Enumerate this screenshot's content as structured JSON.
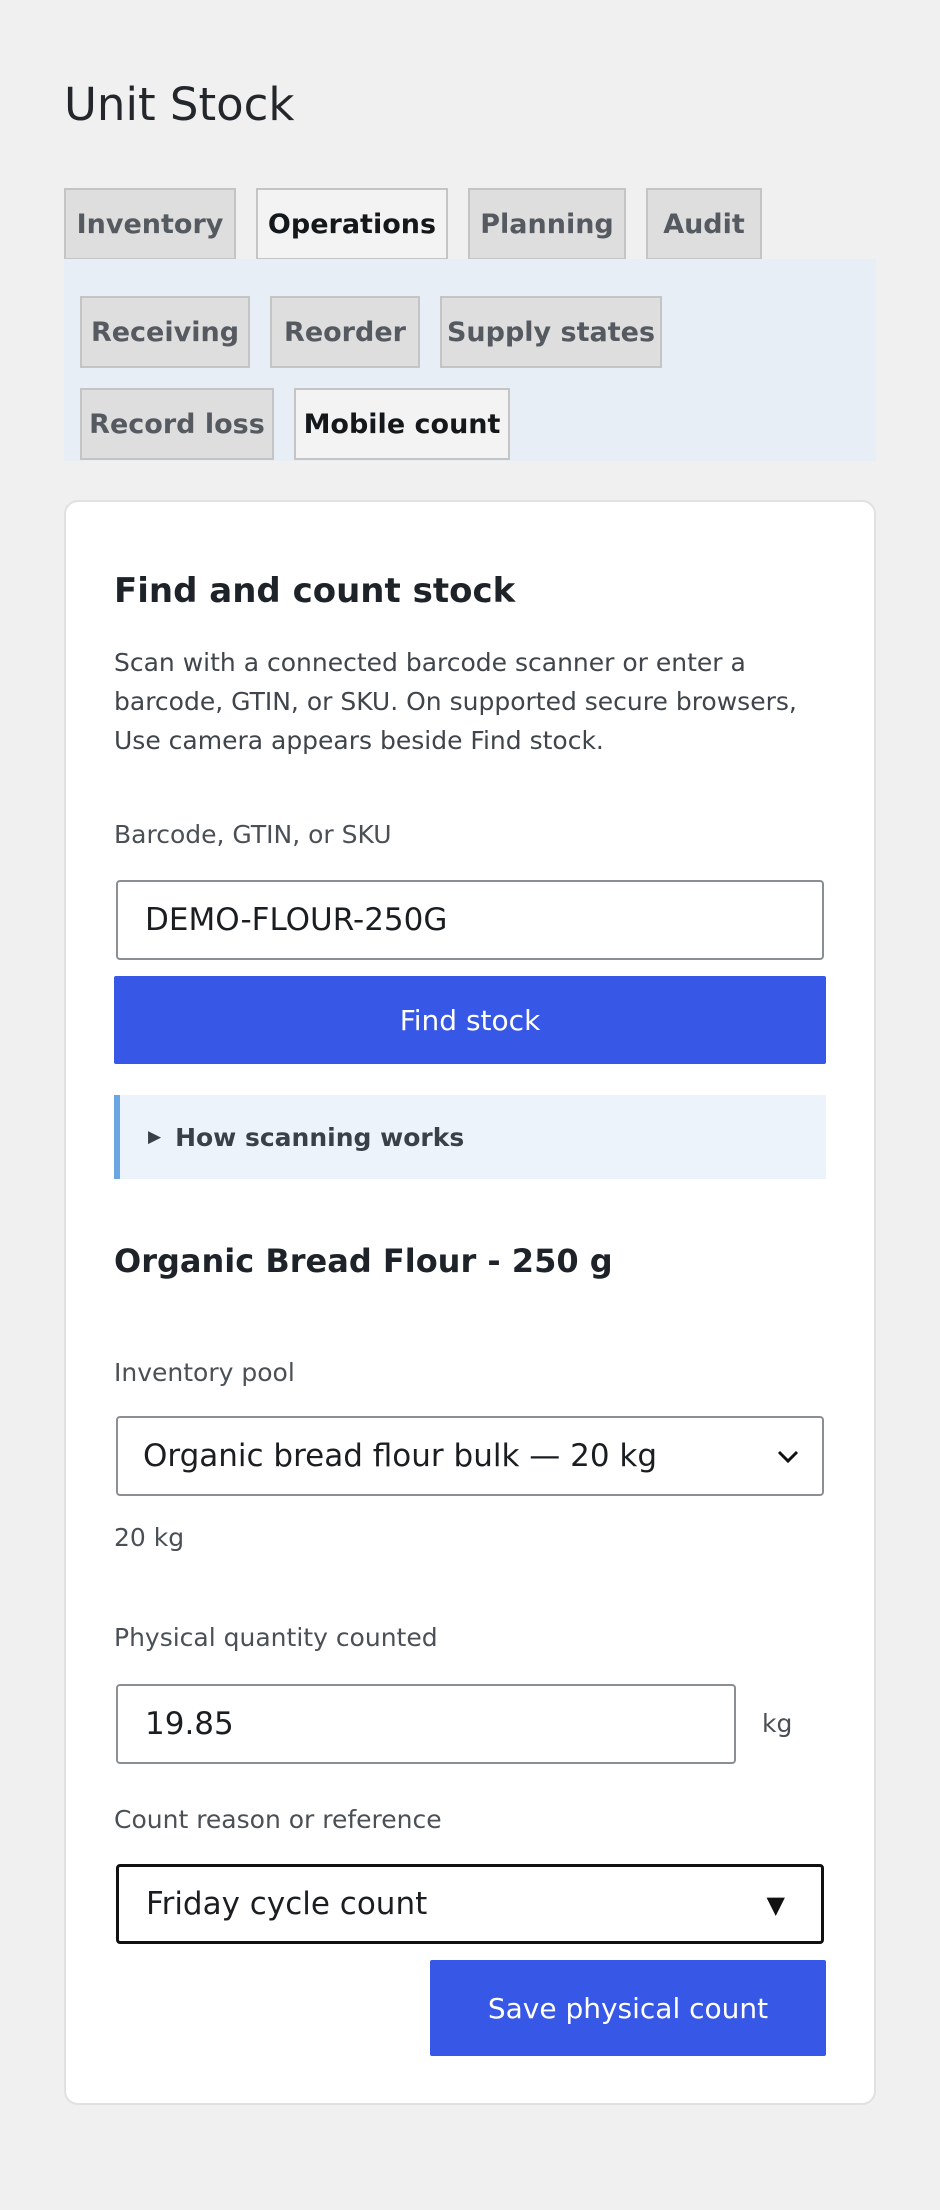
{
  "app": {
    "title": "Unit Stock"
  },
  "main_tabs": [
    {
      "label": "Inventory",
      "active": false
    },
    {
      "label": "Operations",
      "active": true
    },
    {
      "label": "Planning",
      "active": false
    },
    {
      "label": "Audit",
      "active": false
    }
  ],
  "sub_tabs": [
    {
      "label": "Receiving",
      "active": false
    },
    {
      "label": "Reorder",
      "active": false
    },
    {
      "label": "Supply states",
      "active": false
    },
    {
      "label": "Record loss",
      "active": false
    },
    {
      "label": "Mobile count",
      "active": true
    }
  ],
  "finder": {
    "heading": "Find and count stock",
    "description": "Scan with a connected barcode scanner or enter a barcode, GTIN, or SKU. On supported secure browsers, Use camera appears beside Find stock.",
    "barcode_label": "Barcode, GTIN, or SKU",
    "barcode_value": "DEMO-FLOUR-250G",
    "find_button": "Find stock",
    "help_summary": "How scanning works"
  },
  "product": {
    "name": "Organic Bread Flour - 250 g",
    "pool_label": "Inventory pool",
    "pool_value": "Organic bread flour bulk — 20 kg",
    "pool_hint": "20 kg",
    "quantity_label": "Physical quantity counted",
    "quantity_value": "19.85",
    "quantity_unit": "kg",
    "reason_label": "Count reason or reference",
    "reason_value": "Friday cycle count",
    "save_button": "Save physical count"
  },
  "icons": {
    "details_toggle": "triangle-right-icon",
    "pool_select": "chevron-down-icon",
    "reason_select": "caret-down-icon"
  },
  "colors": {
    "primary": "#3757e6",
    "subnav_bg": "#e8eef5",
    "details_accent": "#6ca6e2"
  }
}
